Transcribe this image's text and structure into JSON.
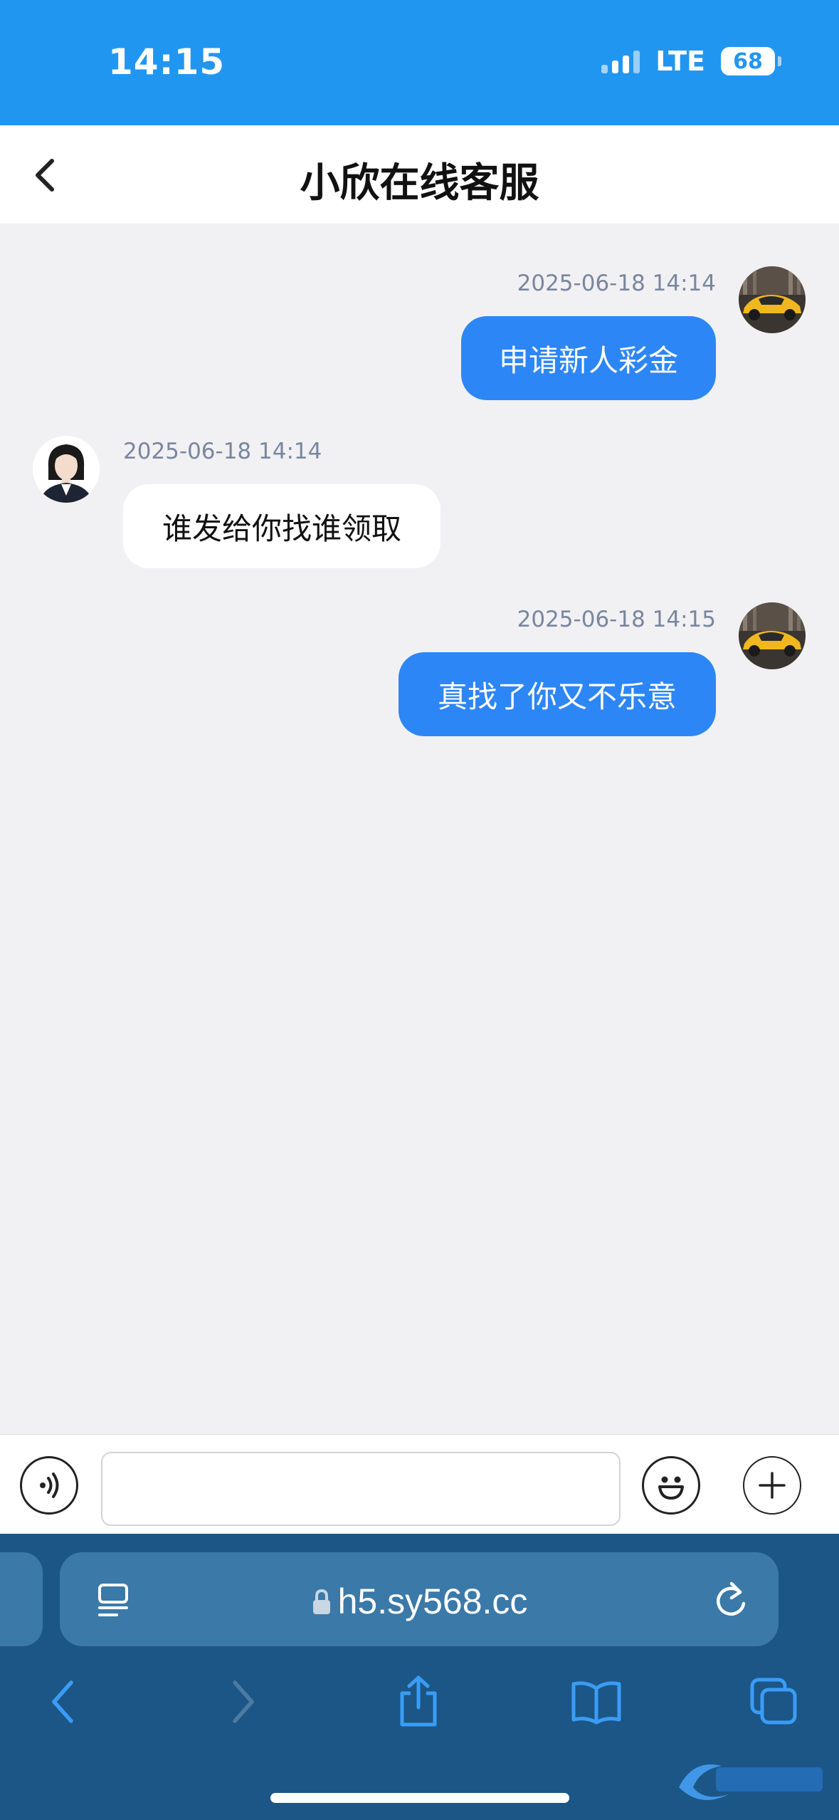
{
  "status_bar": {
    "time": "14:15",
    "network": "LTE",
    "battery": "68"
  },
  "header": {
    "title": "小欣在线客服"
  },
  "messages": [
    {
      "side": "out",
      "time": "2025-06-18 14:14",
      "text": "申请新人彩金"
    },
    {
      "side": "in",
      "time": "2025-06-18 14:14",
      "text": "谁发给你找谁领取"
    },
    {
      "side": "out",
      "time": "2025-06-18 14:15",
      "text": "真找了你又不乐意"
    }
  ],
  "input": {
    "placeholder": "",
    "value": ""
  },
  "browser": {
    "url": "h5.sy568.cc"
  },
  "icons": {
    "back": "chevron-left-icon",
    "voice": "voice-icon",
    "emoji": "emoji-icon",
    "plus": "plus-icon",
    "reader": "reader-icon",
    "lock": "lock-icon",
    "reload": "reload-icon",
    "share": "share-icon",
    "bookmarks": "bookmarks-icon",
    "tabs": "tabs-icon"
  },
  "colors": {
    "status_bar": "#2196f1",
    "bubble_out": "#2d86f5",
    "bubble_in": "#ffffff",
    "chat_bg": "#f1f1f4",
    "browser_bar": "#1c5686"
  }
}
